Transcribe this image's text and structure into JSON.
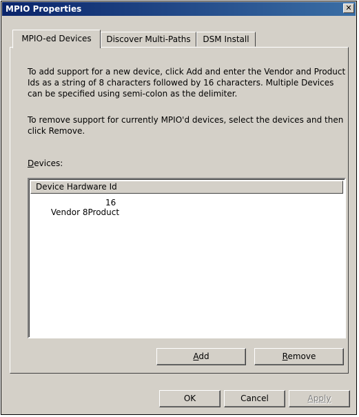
{
  "window": {
    "title": "MPIO Properties",
    "close_glyph": "✕"
  },
  "tabs": [
    {
      "label": "MPIO-ed Devices",
      "active": true
    },
    {
      "label": "Discover Multi-Paths",
      "active": false
    },
    {
      "label": "DSM Install",
      "active": false
    }
  ],
  "main": {
    "description_add": "To add support for a new device, click Add and enter the Vendor and Product Ids as a string of 8 characters followed by 16 characters. Multiple Devices can be specified using semi-colon as the delimiter.",
    "description_remove": "To remove support for currently MPIO'd devices, select the devices and then click Remove.",
    "devices_label_accel": "D",
    "devices_label_rest": "evices:",
    "list": {
      "column_header": "Device Hardware Id",
      "rows": [
        {
          "vendor": "Vendor 8Product",
          "id": "16"
        }
      ]
    },
    "add_button": {
      "accel": "A",
      "rest": "dd"
    },
    "remove_button": {
      "accel": "R",
      "rest": "emove"
    }
  },
  "footer": {
    "ok_label": "OK",
    "cancel_label": "Cancel",
    "apply_label": "Apply",
    "apply_enabled": false
  }
}
